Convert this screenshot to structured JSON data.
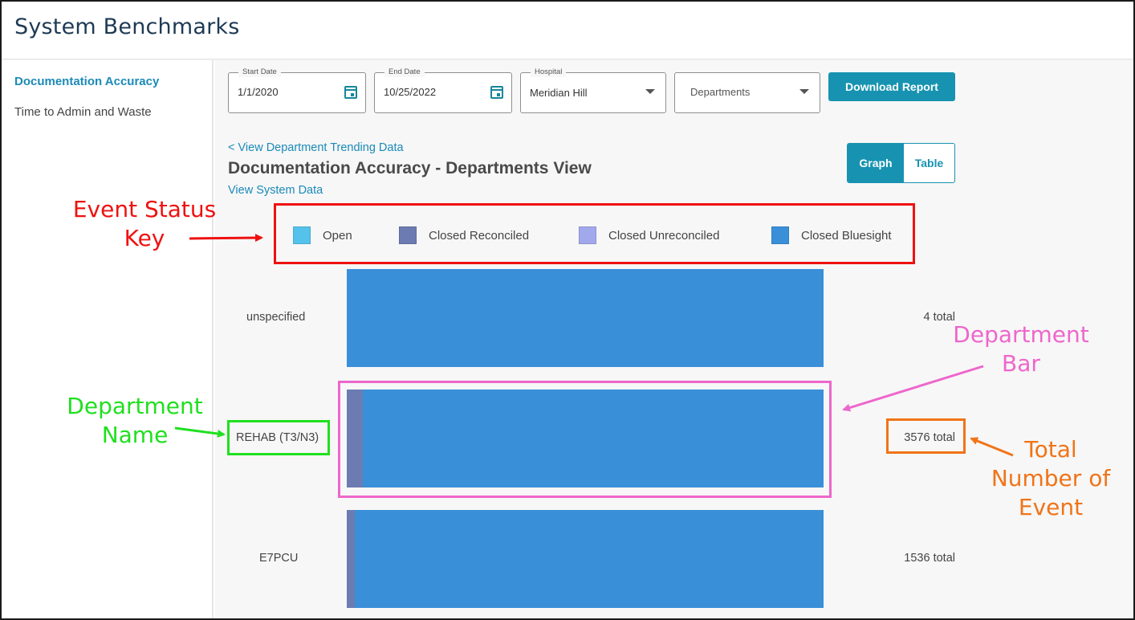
{
  "app": {
    "title": "System Benchmarks"
  },
  "sidebar": {
    "items": [
      {
        "label": "Documentation Accuracy",
        "active": true
      },
      {
        "label": "Time to Admin and Waste",
        "active": false
      }
    ]
  },
  "filters": {
    "start_date": {
      "label": "Start Date",
      "value": "1/1/2020"
    },
    "end_date": {
      "label": "End Date",
      "value": "10/25/2022"
    },
    "hospital": {
      "label": "Hospital",
      "value": "Meridian Hill"
    },
    "departments": {
      "value": "Departments"
    },
    "download_label": "Download Report"
  },
  "view": {
    "back_link": "< View Department Trending Data",
    "title": "Documentation Accuracy - Departments View",
    "system_link": "View System Data",
    "toggle": {
      "graph": "Graph",
      "table": "Table",
      "selected": "graph"
    }
  },
  "legend": [
    {
      "label": "Open",
      "color": "#55c2eb"
    },
    {
      "label": "Closed Reconciled",
      "color": "#6c7cb2"
    },
    {
      "label": "Closed Unreconciled",
      "color": "#a2a8ec"
    },
    {
      "label": "Closed Bluesight",
      "color": "#3a8fd9"
    }
  ],
  "chart_data": {
    "type": "bar",
    "orientation": "horizontal",
    "stacked": "100%",
    "categories": [
      "unspecified",
      "REHAB (T3/N3)",
      "E7PCU"
    ],
    "totals_text": [
      "4 total",
      "3576 total",
      "1536 total"
    ],
    "totals": [
      4,
      3576,
      1536
    ],
    "series": [
      {
        "name": "Open",
        "values": [
          0,
          0,
          0
        ]
      },
      {
        "name": "Closed Reconciled",
        "values": [
          0,
          3.4,
          1.7
        ]
      },
      {
        "name": "Closed Unreconciled",
        "values": [
          0,
          0,
          0
        ]
      },
      {
        "name": "Closed Bluesight",
        "values": [
          100,
          96.6,
          98.3
        ]
      }
    ]
  },
  "annotations": {
    "event_status_key": "Event Status Key",
    "department_name": "Department Name",
    "department_bar": "Department Bar",
    "total_events": "Total Number of Event",
    "colors": {
      "red": "#ee1111",
      "green": "#1fe01f",
      "pink": "#ee66cc",
      "orange": "#f07418"
    }
  }
}
